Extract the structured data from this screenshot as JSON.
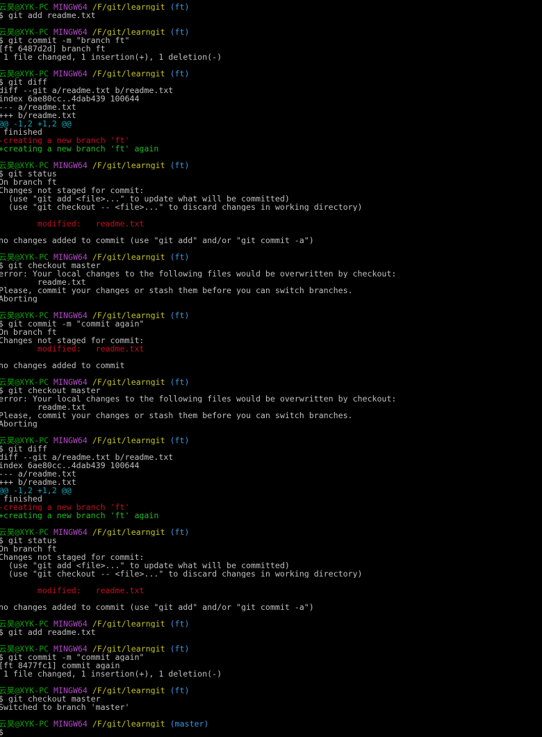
{
  "colors": {
    "background": "#000000",
    "default_text": "#c0c0c0",
    "prompt_user": "#13a10e",
    "prompt_shell": "#b148c6",
    "prompt_path": "#c5c326",
    "prompt_branch": "#3a96dd",
    "removed_or_modified": "#c50f1f",
    "hunk_header": "#16a6b6",
    "added": "#25bc24"
  },
  "terminal": {
    "lines": [
      [
        {
          "t": "云昊@XYK-PC ",
          "c": "green"
        },
        {
          "t": "MINGW64 ",
          "c": "magenta"
        },
        {
          "t": "/F/git/learngit ",
          "c": "yellow"
        },
        {
          "t": "(ft)",
          "c": "cyan"
        }
      ],
      [
        {
          "t": "$ git add readme.txt",
          "c": "white"
        }
      ],
      [],
      [
        {
          "t": "云昊@XYK-PC ",
          "c": "green"
        },
        {
          "t": "MINGW64 ",
          "c": "magenta"
        },
        {
          "t": "/F/git/learngit ",
          "c": "yellow"
        },
        {
          "t": "(ft)",
          "c": "cyan"
        }
      ],
      [
        {
          "t": "$ git commit -m \"branch ft\"",
          "c": "white"
        }
      ],
      [
        {
          "t": "[ft 6487d2d] branch ft",
          "c": "white"
        }
      ],
      [
        {
          "t": " 1 file changed, 1 insertion(+), 1 deletion(-)",
          "c": "white"
        }
      ],
      [],
      [
        {
          "t": "云昊@XYK-PC ",
          "c": "green"
        },
        {
          "t": "MINGW64 ",
          "c": "magenta"
        },
        {
          "t": "/F/git/learngit ",
          "c": "yellow"
        },
        {
          "t": "(ft)",
          "c": "cyan"
        }
      ],
      [
        {
          "t": "$ git diff",
          "c": "white"
        }
      ],
      [
        {
          "t": "diff --git a/readme.txt b/readme.txt",
          "c": "white"
        }
      ],
      [
        {
          "t": "index 6ae80cc..4dab439 100644",
          "c": "white"
        }
      ],
      [
        {
          "t": "--- a/readme.txt",
          "c": "white"
        }
      ],
      [
        {
          "t": "+++ b/readme.txt",
          "c": "white"
        }
      ],
      [
        {
          "t": "@@ -1,2 +1,2 @@",
          "c": "teal"
        }
      ],
      [
        {
          "t": " finished",
          "c": "white"
        }
      ],
      [
        {
          "t": "-creating a new branch 'ft'",
          "c": "red"
        }
      ],
      [
        {
          "t": "+creating a new branch 'ft' again",
          "c": "add"
        }
      ],
      [],
      [
        {
          "t": "云昊@XYK-PC ",
          "c": "green"
        },
        {
          "t": "MINGW64 ",
          "c": "magenta"
        },
        {
          "t": "/F/git/learngit ",
          "c": "yellow"
        },
        {
          "t": "(ft)",
          "c": "cyan"
        }
      ],
      [
        {
          "t": "$ git status",
          "c": "white"
        }
      ],
      [
        {
          "t": "On branch ft",
          "c": "white"
        }
      ],
      [
        {
          "t": "Changes not staged for commit:",
          "c": "white"
        }
      ],
      [
        {
          "t": "  (use \"git add <file>...\" to update what will be committed)",
          "c": "white"
        }
      ],
      [
        {
          "t": "  (use \"git checkout -- <file>...\" to discard changes in working directory)",
          "c": "white"
        }
      ],
      [],
      [
        {
          "t": "        modified:   readme.txt",
          "c": "red"
        }
      ],
      [],
      [
        {
          "t": "no changes added to commit (use \"git add\" and/or \"git commit -a\")",
          "c": "white"
        }
      ],
      [],
      [
        {
          "t": "云昊@XYK-PC ",
          "c": "green"
        },
        {
          "t": "MINGW64 ",
          "c": "magenta"
        },
        {
          "t": "/F/git/learngit ",
          "c": "yellow"
        },
        {
          "t": "(ft)",
          "c": "cyan"
        }
      ],
      [
        {
          "t": "$ git checkout master",
          "c": "white"
        }
      ],
      [
        {
          "t": "error: Your local changes to the following files would be overwritten by checkout:",
          "c": "white"
        }
      ],
      [
        {
          "t": "        readme.txt",
          "c": "white"
        }
      ],
      [
        {
          "t": "Please, commit your changes or stash them before you can switch branches.",
          "c": "white"
        }
      ],
      [
        {
          "t": "Aborting",
          "c": "white"
        }
      ],
      [],
      [
        {
          "t": "云昊@XYK-PC ",
          "c": "green"
        },
        {
          "t": "MINGW64 ",
          "c": "magenta"
        },
        {
          "t": "/F/git/learngit ",
          "c": "yellow"
        },
        {
          "t": "(ft)",
          "c": "cyan"
        }
      ],
      [
        {
          "t": "$ git commit -m \"commit again\"",
          "c": "white"
        }
      ],
      [
        {
          "t": "On branch ft",
          "c": "white"
        }
      ],
      [
        {
          "t": "Changes not staged for commit:",
          "c": "white"
        }
      ],
      [
        {
          "t": "        modified:   readme.txt",
          "c": "red"
        }
      ],
      [],
      [
        {
          "t": "no changes added to commit",
          "c": "white"
        }
      ],
      [],
      [
        {
          "t": "云昊@XYK-PC ",
          "c": "green"
        },
        {
          "t": "MINGW64 ",
          "c": "magenta"
        },
        {
          "t": "/F/git/learngit ",
          "c": "yellow"
        },
        {
          "t": "(ft)",
          "c": "cyan"
        }
      ],
      [
        {
          "t": "$ git checkout master",
          "c": "white"
        }
      ],
      [
        {
          "t": "error: Your local changes to the following files would be overwritten by checkout:",
          "c": "white"
        }
      ],
      [
        {
          "t": "        readme.txt",
          "c": "white"
        }
      ],
      [
        {
          "t": "Please, commit your changes or stash them before you can switch branches.",
          "c": "white"
        }
      ],
      [
        {
          "t": "Aborting",
          "c": "white"
        }
      ],
      [],
      [
        {
          "t": "云昊@XYK-PC ",
          "c": "green"
        },
        {
          "t": "MINGW64 ",
          "c": "magenta"
        },
        {
          "t": "/F/git/learngit ",
          "c": "yellow"
        },
        {
          "t": "(ft)",
          "c": "cyan"
        }
      ],
      [
        {
          "t": "$ git diff",
          "c": "white"
        }
      ],
      [
        {
          "t": "diff --git a/readme.txt b/readme.txt",
          "c": "white"
        }
      ],
      [
        {
          "t": "index 6ae80cc..4dab439 100644",
          "c": "white"
        }
      ],
      [
        {
          "t": "--- a/readme.txt",
          "c": "white"
        }
      ],
      [
        {
          "t": "+++ b/readme.txt",
          "c": "white"
        }
      ],
      [
        {
          "t": "@@ -1,2 +1,2 @@",
          "c": "teal"
        }
      ],
      [
        {
          "t": " finished",
          "c": "white"
        }
      ],
      [
        {
          "t": "-creating a new branch 'ft'",
          "c": "red"
        }
      ],
      [
        {
          "t": "+creating a new branch 'ft' again",
          "c": "add"
        }
      ],
      [],
      [
        {
          "t": "云昊@XYK-PC ",
          "c": "green"
        },
        {
          "t": "MINGW64 ",
          "c": "magenta"
        },
        {
          "t": "/F/git/learngit ",
          "c": "yellow"
        },
        {
          "t": "(ft)",
          "c": "cyan"
        }
      ],
      [
        {
          "t": "$ git status",
          "c": "white"
        }
      ],
      [
        {
          "t": "On branch ft",
          "c": "white"
        }
      ],
      [
        {
          "t": "Changes not staged for commit:",
          "c": "white"
        }
      ],
      [
        {
          "t": "  (use \"git add <file>...\" to update what will be committed)",
          "c": "white"
        }
      ],
      [
        {
          "t": "  (use \"git checkout -- <file>...\" to discard changes in working directory)",
          "c": "white"
        }
      ],
      [],
      [
        {
          "t": "        modified:   readme.txt",
          "c": "red"
        }
      ],
      [],
      [
        {
          "t": "no changes added to commit (use \"git add\" and/or \"git commit -a\")",
          "c": "white"
        }
      ],
      [],
      [
        {
          "t": "云昊@XYK-PC ",
          "c": "green"
        },
        {
          "t": "MINGW64 ",
          "c": "magenta"
        },
        {
          "t": "/F/git/learngit ",
          "c": "yellow"
        },
        {
          "t": "(ft)",
          "c": "cyan"
        }
      ],
      [
        {
          "t": "$ git add readme.txt",
          "c": "white"
        }
      ],
      [],
      [
        {
          "t": "云昊@XYK-PC ",
          "c": "green"
        },
        {
          "t": "MINGW64 ",
          "c": "magenta"
        },
        {
          "t": "/F/git/learngit ",
          "c": "yellow"
        },
        {
          "t": "(ft)",
          "c": "cyan"
        }
      ],
      [
        {
          "t": "$ git commit -m \"commit again\"",
          "c": "white"
        }
      ],
      [
        {
          "t": "[ft 8477fc1] commit again",
          "c": "white"
        }
      ],
      [
        {
          "t": " 1 file changed, 1 insertion(+), 1 deletion(-)",
          "c": "white"
        }
      ],
      [],
      [
        {
          "t": "云昊@XYK-PC ",
          "c": "green"
        },
        {
          "t": "MINGW64 ",
          "c": "magenta"
        },
        {
          "t": "/F/git/learngit ",
          "c": "yellow"
        },
        {
          "t": "(ft)",
          "c": "cyan"
        }
      ],
      [
        {
          "t": "$ git checkout master",
          "c": "white"
        }
      ],
      [
        {
          "t": "Switched to branch 'master'",
          "c": "white"
        }
      ],
      [],
      [
        {
          "t": "云昊@XYK-PC ",
          "c": "green"
        },
        {
          "t": "MINGW64 ",
          "c": "magenta"
        },
        {
          "t": "/F/git/learngit ",
          "c": "yellow"
        },
        {
          "t": "(master)",
          "c": "cyan"
        }
      ],
      [
        {
          "t": "$",
          "c": "white"
        }
      ]
    ]
  }
}
